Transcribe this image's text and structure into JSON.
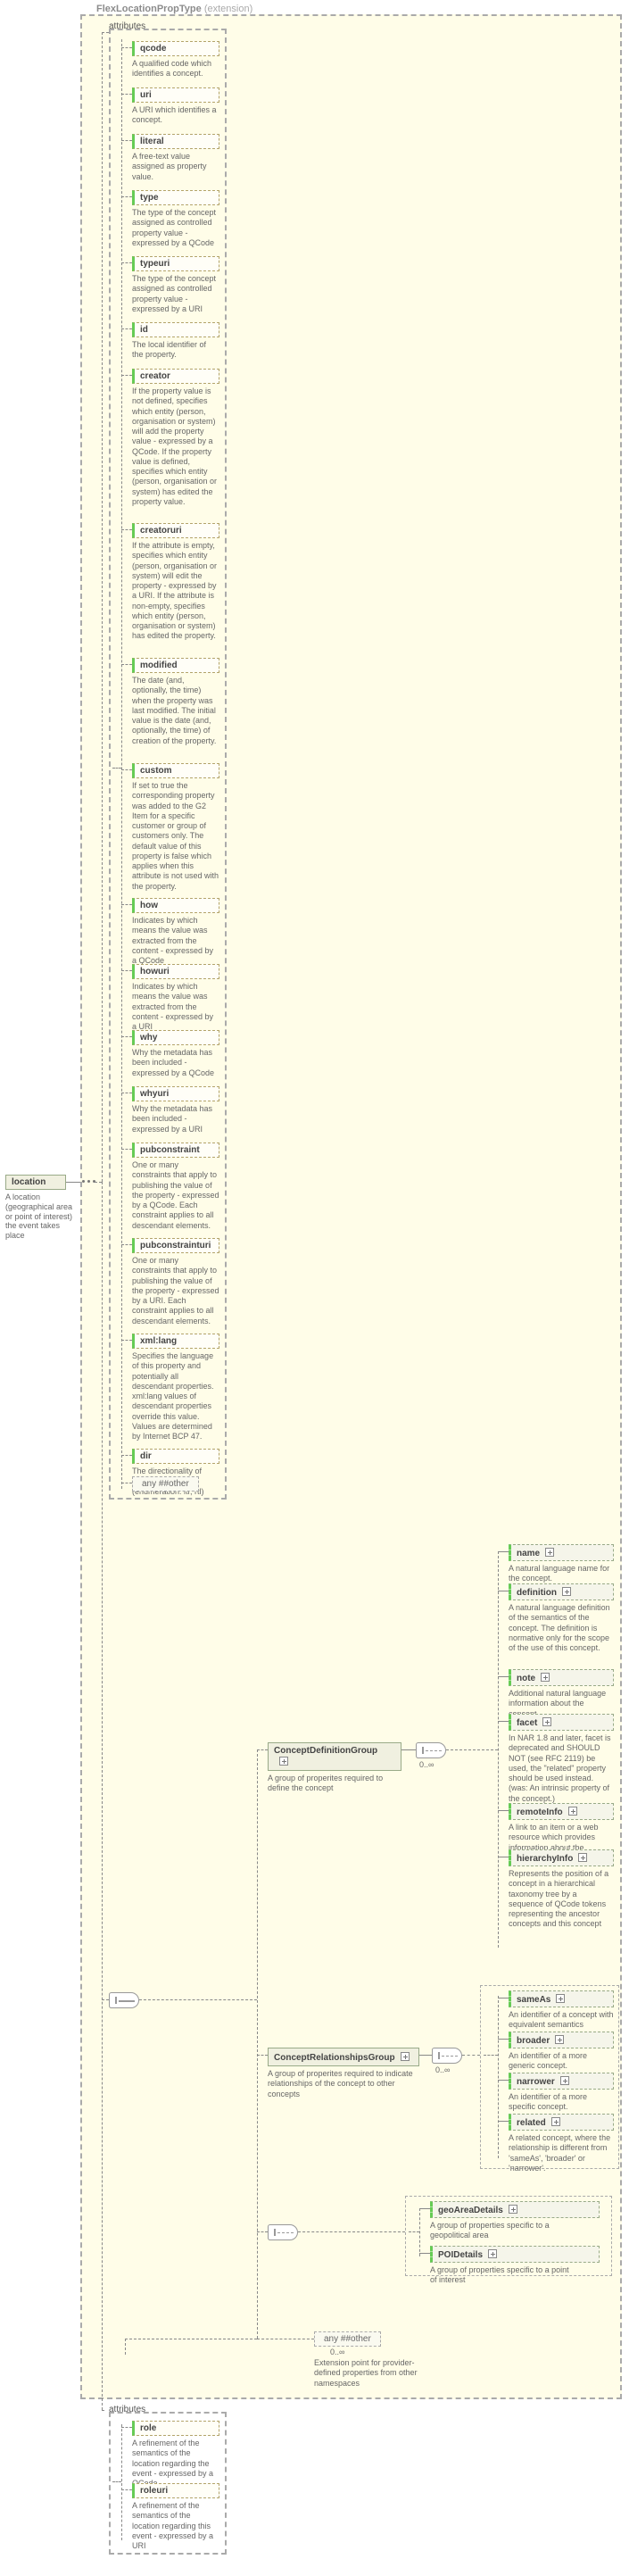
{
  "header": {
    "title": "FlexLocationPropType",
    "suffix": " (extension)"
  },
  "root": {
    "name": "location",
    "desc": "A location (geographical area or point of interest) the event takes place"
  },
  "attrs_label": "attributes",
  "attributes": [
    {
      "name": "qcode",
      "desc": "A qualified code which identifies a concept."
    },
    {
      "name": "uri",
      "desc": "A URI which identifies a concept."
    },
    {
      "name": "literal",
      "desc": "A free-text value assigned as property value."
    },
    {
      "name": "type",
      "desc": "The type of the concept assigned as controlled property value - expressed by a QCode"
    },
    {
      "name": "typeuri",
      "desc": "The type of the concept assigned as controlled property value - expressed by a URI"
    },
    {
      "name": "id",
      "desc": "The local identifier of the property."
    },
    {
      "name": "creator",
      "desc": "If the property value is not defined, specifies which entity (person, organisation or system) will add the property value - expressed by a QCode. If the property value is defined, specifies which entity (person, organisation or system) has edited the property value."
    },
    {
      "name": "creatoruri",
      "desc": "If the attribute is empty, specifies which entity (person, organisation or system) will edit the property - expressed by a URI. If the attribute is non-empty, specifies which entity (person, organisation or system) has edited the property."
    },
    {
      "name": "modified",
      "desc": "The date (and, optionally, the time) when the property was last modified. The initial value is the date (and, optionally, the time) of creation of the property."
    },
    {
      "name": "custom",
      "desc": "If set to true the corresponding property was added to the G2 Item for a specific customer or group of customers only. The default value of this property is false which applies when this attribute is not used with the property."
    },
    {
      "name": "how",
      "desc": "Indicates by which means the value was extracted from the content - expressed by a QCode"
    },
    {
      "name": "howuri",
      "desc": "Indicates by which means the value was extracted from the content - expressed by a URI"
    },
    {
      "name": "why",
      "desc": "Why the metadata has been included - expressed by a QCode"
    },
    {
      "name": "whyuri",
      "desc": "Why the metadata has been included - expressed by a URI"
    },
    {
      "name": "pubconstraint",
      "desc": "One or many constraints that apply to publishing the value of the property - expressed by a QCode. Each constraint applies to all descendant elements."
    },
    {
      "name": "pubconstrainturi",
      "desc": "One or many constraints that apply to publishing the value of the property - expressed by a URI. Each constraint applies to all descendant elements."
    },
    {
      "name": "xml:lang",
      "desc": "Specifies the language of this property and potentially all descendant properties. xml:lang values of descendant properties override this value. Values are determined by Internet BCP 47."
    },
    {
      "name": "dir",
      "desc": "The directionality of textual content (enumeration: ltr, rtl)"
    }
  ],
  "any1": "any ##other",
  "groups": {
    "def": {
      "label": "ConceptDefinitionGroup",
      "desc": "A group of properites required to define the concept",
      "occ": "0..∞"
    },
    "rel": {
      "label": "ConceptRelationshipsGroup",
      "desc": "A group of properites required to indicate relationships of the concept to other concepts",
      "occ": "0..∞"
    }
  },
  "defElts": [
    {
      "name": "name",
      "desc": "A natural language name for the concept."
    },
    {
      "name": "definition",
      "desc": "A natural language definition of the semantics of the concept. The definition is normative only for the scope of the use of this concept."
    },
    {
      "name": "note",
      "desc": "Additional natural language information about the concept."
    },
    {
      "name": "facet",
      "desc": "In NAR 1.8 and later, facet is deprecated and SHOULD NOT (see RFC 2119) be used, the \"related\" property should be used instead. (was: An intrinsic property of the concept.)"
    },
    {
      "name": "remoteInfo",
      "desc": "A link to an item or a web resource which provides information about the concept"
    },
    {
      "name": "hierarchyInfo",
      "desc": "Represents the position of a concept in a hierarchical taxonomy tree by a sequence of QCode tokens representing the ancestor concepts and this concept"
    }
  ],
  "relElts": [
    {
      "name": "sameAs",
      "desc": "An identifier of a concept with equivalent semantics"
    },
    {
      "name": "broader",
      "desc": "An identifier of a more generic concept."
    },
    {
      "name": "narrower",
      "desc": "An identifier of a more specific concept."
    },
    {
      "name": "related",
      "desc": "A related concept, where the relationship is different from 'sameAs', 'broader' or 'narrower'."
    }
  ],
  "geoElts": [
    {
      "name": "geoAreaDetails",
      "desc": "A group of properties specific to a geopolitical area"
    },
    {
      "name": "POIDetails",
      "desc": "A group of properties specific to a point of interest"
    }
  ],
  "any2": {
    "label": "any ##other",
    "occ": "0..∞",
    "desc": "Extension point for provider-defined properties from other namespaces"
  },
  "attrs2_label": "attributes",
  "attrs2": [
    {
      "name": "role",
      "desc": "A refinement of the semantics of the location regarding the event - expressed by a QCode"
    },
    {
      "name": "roleuri",
      "desc": "A refinement of the semantics of the location regarding this event - expressed by a URI"
    }
  ]
}
